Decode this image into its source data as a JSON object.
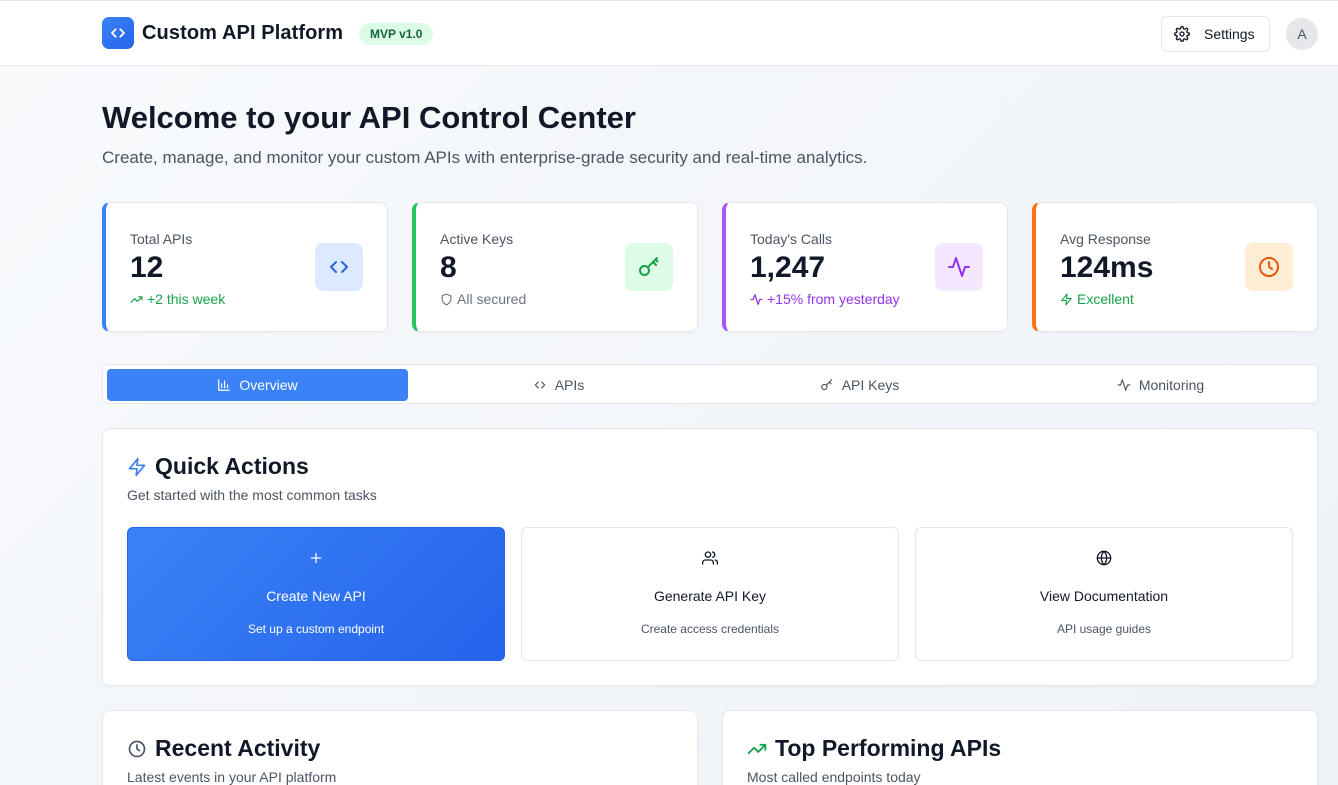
{
  "header": {
    "app_title": "Custom API Platform",
    "version_badge": "MVP v1.0",
    "settings_label": "Settings",
    "avatar_initial": "A"
  },
  "welcome": {
    "title": "Welcome to your API Control Center",
    "subtitle": "Create, manage, and monitor your custom APIs with enterprise-grade security and real-time analytics."
  },
  "stats": [
    {
      "label": "Total APIs",
      "value": "12",
      "note": "+2 this week",
      "accent": "#3b82f6",
      "note_color": "#16a34a",
      "note_icon": "trending-up-icon",
      "icon": "code-icon",
      "icon_bg": "#dbeafe",
      "icon_color": "#2563eb"
    },
    {
      "label": "Active Keys",
      "value": "8",
      "note": "All secured",
      "accent": "#22c55e",
      "note_color": "#6b7280",
      "note_icon": "shield-icon",
      "icon": "key-icon",
      "icon_bg": "#dcfce7",
      "icon_color": "#16a34a"
    },
    {
      "label": "Today's Calls",
      "value": "1,247",
      "note": "+15% from yesterday",
      "accent": "#a855f7",
      "note_color": "#9333ea",
      "note_icon": "activity-icon",
      "icon": "activity-icon",
      "icon_bg": "#f3e8ff",
      "icon_color": "#9333ea"
    },
    {
      "label": "Avg Response",
      "value": "124ms",
      "note": "Excellent",
      "accent": "#f97316",
      "note_color": "#16a34a",
      "note_icon": "zap-icon",
      "icon": "clock-icon",
      "icon_bg": "#ffedd5",
      "icon_color": "#ea580c"
    }
  ],
  "tabs": [
    {
      "label": "Overview",
      "icon": "bar-chart-icon",
      "active": true
    },
    {
      "label": "APIs",
      "icon": "code-icon",
      "active": false
    },
    {
      "label": "API Keys",
      "icon": "key-icon",
      "active": false
    },
    {
      "label": "Monitoring",
      "icon": "activity-icon",
      "active": false
    }
  ],
  "quick_actions": {
    "title": "Quick Actions",
    "subtitle": "Get started with the most common tasks",
    "items": [
      {
        "title": "Create New API",
        "subtitle": "Set up a custom endpoint",
        "icon": "plus-icon"
      },
      {
        "title": "Generate API Key",
        "subtitle": "Create access credentials",
        "icon": "users-icon"
      },
      {
        "title": "View Documentation",
        "subtitle": "API usage guides",
        "icon": "globe-icon"
      }
    ]
  },
  "recent_activity": {
    "title": "Recent Activity",
    "subtitle": "Latest events in your API platform"
  },
  "top_apis": {
    "title": "Top Performing APIs",
    "subtitle": "Most called endpoints today"
  },
  "colors": {
    "primary": "#3b82f6",
    "primary_dark": "#2563eb",
    "badge_bg": "#dcfce7",
    "badge_text": "#166534"
  }
}
